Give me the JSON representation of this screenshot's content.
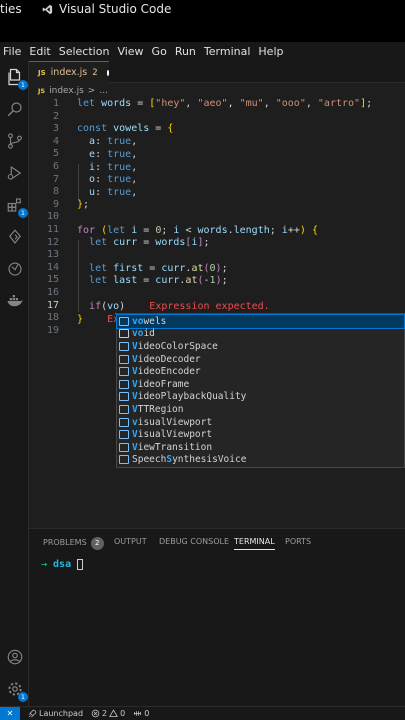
{
  "os_bar": {
    "left_text": "ties",
    "app_name": "Visual Studio Code"
  },
  "menu": [
    "File",
    "Edit",
    "Selection",
    "View",
    "Go",
    "Run",
    "Terminal",
    "Help"
  ],
  "activity_bar": {
    "explorer_badge": "1",
    "extensions_badge": "1",
    "settings_badge": "1"
  },
  "tab": {
    "icon_text": "JS",
    "filename": "index.js",
    "problem_count": "2"
  },
  "breadcrumb": {
    "icon_text": "JS",
    "file": "index.js",
    "separator": ">",
    "rest": "..."
  },
  "editor": {
    "line_numbers": [
      "1",
      "2",
      "3",
      "4",
      "5",
      "6",
      "7",
      "8",
      "9",
      "10",
      "11",
      "12",
      "13",
      "14",
      "15",
      "16",
      "17",
      "18",
      "19"
    ],
    "error_text": "Expression expected.",
    "error_text_line18": "Ex"
  },
  "suggestions": [
    {
      "icon": "var",
      "text_before": "",
      "match": "vo",
      "text_after": "wels",
      "selected": true
    },
    {
      "icon": "kw",
      "text_before": "",
      "match": "vo",
      "text_after": "id",
      "selected": false
    },
    {
      "icon": "var",
      "text_before": "",
      "match": "V",
      "text_after": "ideoColorSpace",
      "selected": false
    },
    {
      "icon": "var",
      "text_before": "",
      "match": "V",
      "text_after": "ideoDecoder",
      "selected": false
    },
    {
      "icon": "var",
      "text_before": "",
      "match": "V",
      "text_after": "ideoEncoder",
      "selected": false
    },
    {
      "icon": "var",
      "text_before": "",
      "match": "V",
      "text_after": "ideoFrame",
      "selected": false
    },
    {
      "icon": "var",
      "text_before": "",
      "match": "V",
      "text_after": "ideoPlaybackQuality",
      "selected": false
    },
    {
      "icon": "var",
      "text_before": "",
      "match": "V",
      "text_after": "TTRegion",
      "selected": false
    },
    {
      "icon": "var",
      "text_before": "",
      "match": "v",
      "text_after": "isualViewport",
      "selected": false
    },
    {
      "icon": "var",
      "text_before": "",
      "match": "V",
      "text_after": "isualViewport",
      "selected": false
    },
    {
      "icon": "var",
      "text_before": "",
      "match": "V",
      "text_after": "iewTransition",
      "selected": false
    },
    {
      "icon": "var",
      "text_before": "Speech",
      "match": "S",
      "text_after": "ynthesisVoice",
      "selected": false
    }
  ],
  "panel": {
    "tabs": [
      {
        "label": "PROBLEMS",
        "badge": "2"
      },
      {
        "label": "OUTPUT"
      },
      {
        "label": "DEBUG CONSOLE"
      },
      {
        "label": "TERMINAL",
        "active": true
      },
      {
        "label": "PORTS"
      }
    ],
    "prompt_arrow": "→",
    "prompt_dir": "dsa"
  },
  "status": {
    "remote": "✕",
    "launchpad": "Launchpad",
    "errors": "2",
    "warnings": "0",
    "ports": "0"
  }
}
